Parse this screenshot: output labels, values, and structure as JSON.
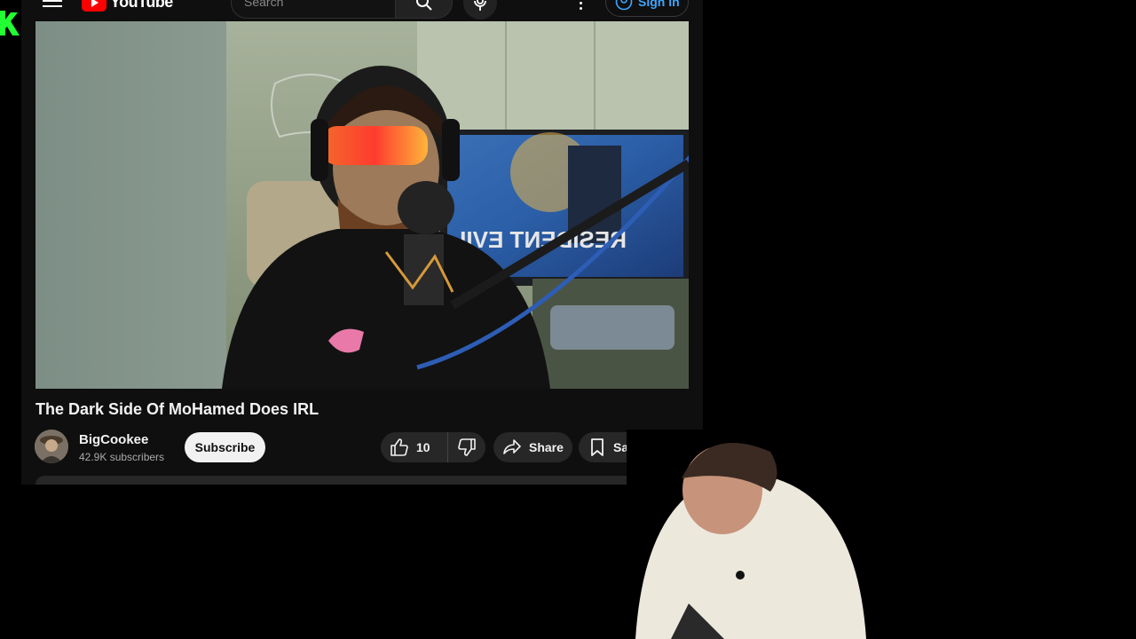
{
  "masthead": {
    "logo_text": "YouTube",
    "search_placeholder": "Search",
    "signin_label": "Sign in"
  },
  "video": {
    "title": "The Dark Side Of MoHamed Does IRL",
    "monitor_text": "RESIDENT EVIL"
  },
  "channel": {
    "name": "BigCookee",
    "subscribers": "42.9K subscribers",
    "subscribe_label": "Subscribe"
  },
  "actions": {
    "like_count": "10",
    "share_label": "Share",
    "save_label": "Save"
  },
  "colors": {
    "background": "#000000",
    "page": "#0f0f0f",
    "pill": "#272727",
    "subscribe_bg": "#f1f1f1",
    "accent_red": "#ff0000",
    "corner_mark": "#22ff33"
  },
  "icons": [
    "menu-icon",
    "youtube-logo-icon",
    "search-icon",
    "mic-icon",
    "more-vert-icon",
    "account-icon",
    "like-icon",
    "dislike-icon",
    "share-icon",
    "save-icon",
    "more-horiz-icon"
  ]
}
